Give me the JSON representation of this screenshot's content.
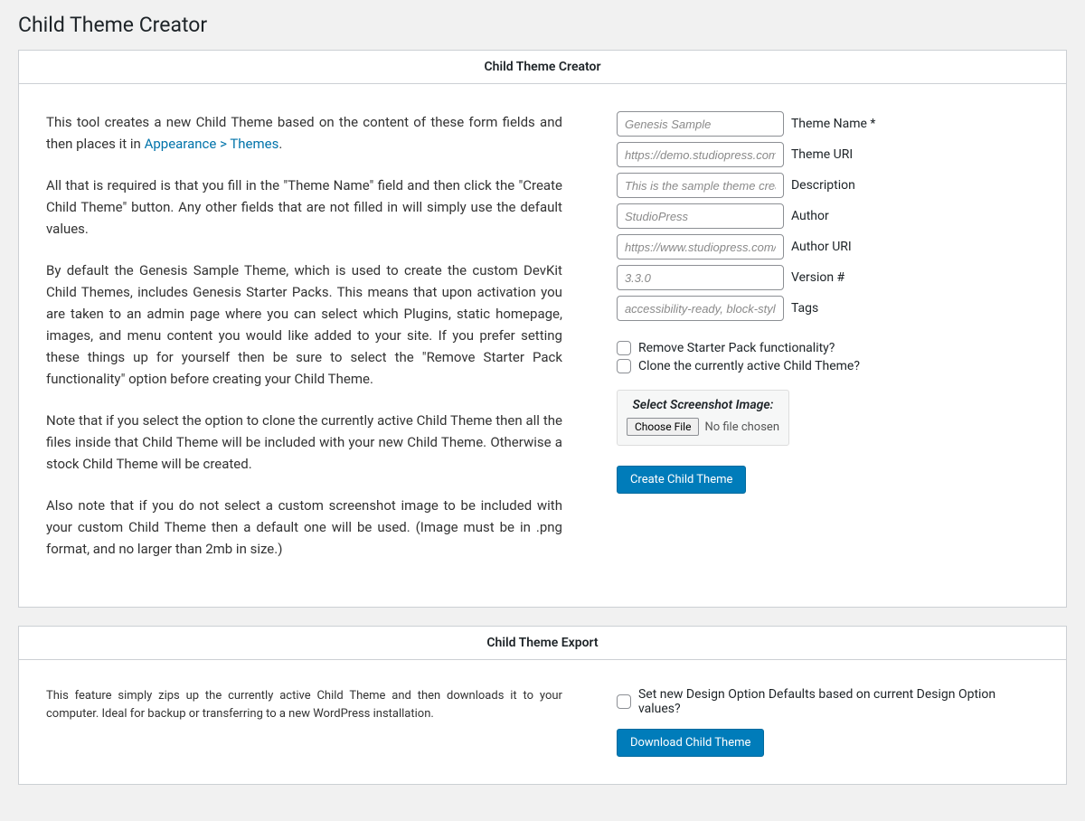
{
  "page": {
    "title": "Child Theme Creator"
  },
  "creator": {
    "header": "Child Theme Creator",
    "intro": {
      "p1a": "This tool creates a new Child Theme based on the content of these form fields and then places it in ",
      "p1link": "Appearance > Themes",
      "p1b": ".",
      "p2": "All that is required is that you fill in the \"Theme Name\" field and then click the \"Create Child Theme\" button. Any other fields that are not filled in will simply use the default values.",
      "p3": "By default the Genesis Sample Theme, which is used to create the custom DevKit Child Themes, includes Genesis Starter Packs. This means that upon activation you are taken to an admin page where you can select which Plugins, static homepage, images, and menu content you would like added to your site. If you prefer setting these things up for yourself then be sure to select the \"Remove Starter Pack functionality\" option before creating your Child Theme.",
      "p4": "Note that if you select the option to clone the currently active Child Theme then all the files inside that Child Theme will be included with your new Child Theme. Otherwise a stock Child Theme will be created.",
      "p5": "Also note that if you do not select a custom screenshot image to be included with your custom Child Theme then a default one will be used. (Image must be in .png format, and no larger than 2mb in size.)"
    },
    "fields": {
      "theme_name": {
        "placeholder": "Genesis Sample",
        "label": "Theme Name *"
      },
      "theme_uri": {
        "placeholder": "https://demo.studiopress.com/",
        "label": "Theme URI"
      },
      "description": {
        "placeholder": "This is the sample theme created",
        "label": "Description"
      },
      "author": {
        "placeholder": "StudioPress",
        "label": "Author"
      },
      "author_uri": {
        "placeholder": "https://www.studiopress.com/",
        "label": "Author URI"
      },
      "version": {
        "placeholder": "3.3.0",
        "label": "Version #"
      },
      "tags": {
        "placeholder": "accessibility-ready, block-styles,",
        "label": "Tags"
      }
    },
    "checks": {
      "remove_starter": "Remove Starter Pack functionality?",
      "clone_theme": "Clone the currently active Child Theme?"
    },
    "screenshot": {
      "title": "Select Screenshot Image:",
      "choose": "Choose File",
      "status": "No file chosen"
    },
    "submit": "Create Child Theme"
  },
  "export": {
    "header": "Child Theme Export",
    "desc": "This feature simply zips up the currently active Child Theme and then downloads it to your computer. Ideal for backup or transferring to a new WordPress installation.",
    "check": "Set new Design Option Defaults based on current Design Option values?",
    "submit": "Download Child Theme"
  }
}
